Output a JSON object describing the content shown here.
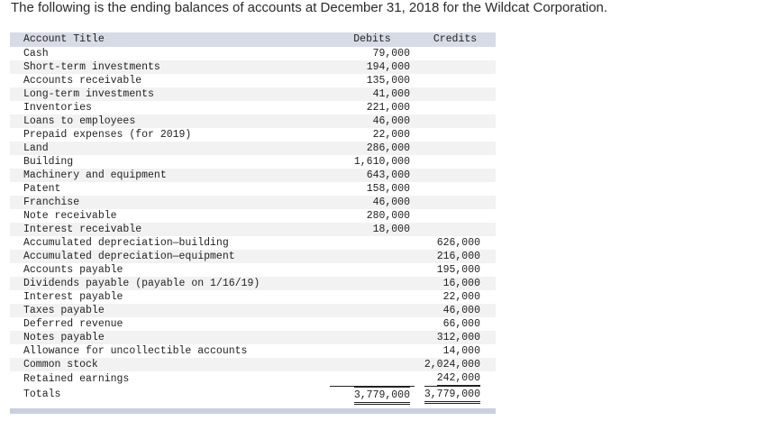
{
  "intro_text": "The following is the ending balances of accounts at December 31, 2018 for the Wildcat Corporation.",
  "table": {
    "headers": {
      "title": "Account Title",
      "debits": "Debits",
      "credits": "Credits"
    },
    "rows": [
      {
        "title": "Cash",
        "debit": "79,000",
        "credit": ""
      },
      {
        "title": "Short-term investments",
        "debit": "194,000",
        "credit": ""
      },
      {
        "title": "Accounts receivable",
        "debit": "135,000",
        "credit": ""
      },
      {
        "title": "Long-term investments",
        "debit": "41,000",
        "credit": ""
      },
      {
        "title": "Inventories",
        "debit": "221,000",
        "credit": ""
      },
      {
        "title": "Loans to employees",
        "debit": "46,000",
        "credit": ""
      },
      {
        "title": "Prepaid expenses (for 2019)",
        "debit": "22,000",
        "credit": ""
      },
      {
        "title": "Land",
        "debit": "286,000",
        "credit": ""
      },
      {
        "title": "Building",
        "debit": "1,610,000",
        "credit": ""
      },
      {
        "title": "Machinery and equipment",
        "debit": "643,000",
        "credit": ""
      },
      {
        "title": "Patent",
        "debit": "158,000",
        "credit": ""
      },
      {
        "title": "Franchise",
        "debit": "46,000",
        "credit": ""
      },
      {
        "title": "Note receivable",
        "debit": "280,000",
        "credit": ""
      },
      {
        "title": "Interest receivable",
        "debit": "18,000",
        "credit": ""
      },
      {
        "title": "Accumulated depreciation—building",
        "debit": "",
        "credit": "626,000"
      },
      {
        "title": "Accumulated depreciation—equipment",
        "debit": "",
        "credit": "216,000"
      },
      {
        "title": "Accounts payable",
        "debit": "",
        "credit": "195,000"
      },
      {
        "title": "Dividends payable (payable on 1/16/19)",
        "debit": "",
        "credit": "16,000"
      },
      {
        "title": "Interest payable",
        "debit": "",
        "credit": "22,000"
      },
      {
        "title": "Taxes payable",
        "debit": "",
        "credit": "46,000"
      },
      {
        "title": "Deferred revenue",
        "debit": "",
        "credit": "66,000"
      },
      {
        "title": "Notes payable",
        "debit": "",
        "credit": "312,000"
      },
      {
        "title": "Allowance for uncollectible accounts",
        "debit": "",
        "credit": "14,000"
      },
      {
        "title": "Common stock",
        "debit": "",
        "credit": "2,024,000"
      },
      {
        "title": "Retained earnings",
        "debit": "",
        "credit": "242,000"
      }
    ],
    "totals": {
      "title": "Totals",
      "debit": "3,779,000",
      "credit": "3,779,000"
    }
  }
}
